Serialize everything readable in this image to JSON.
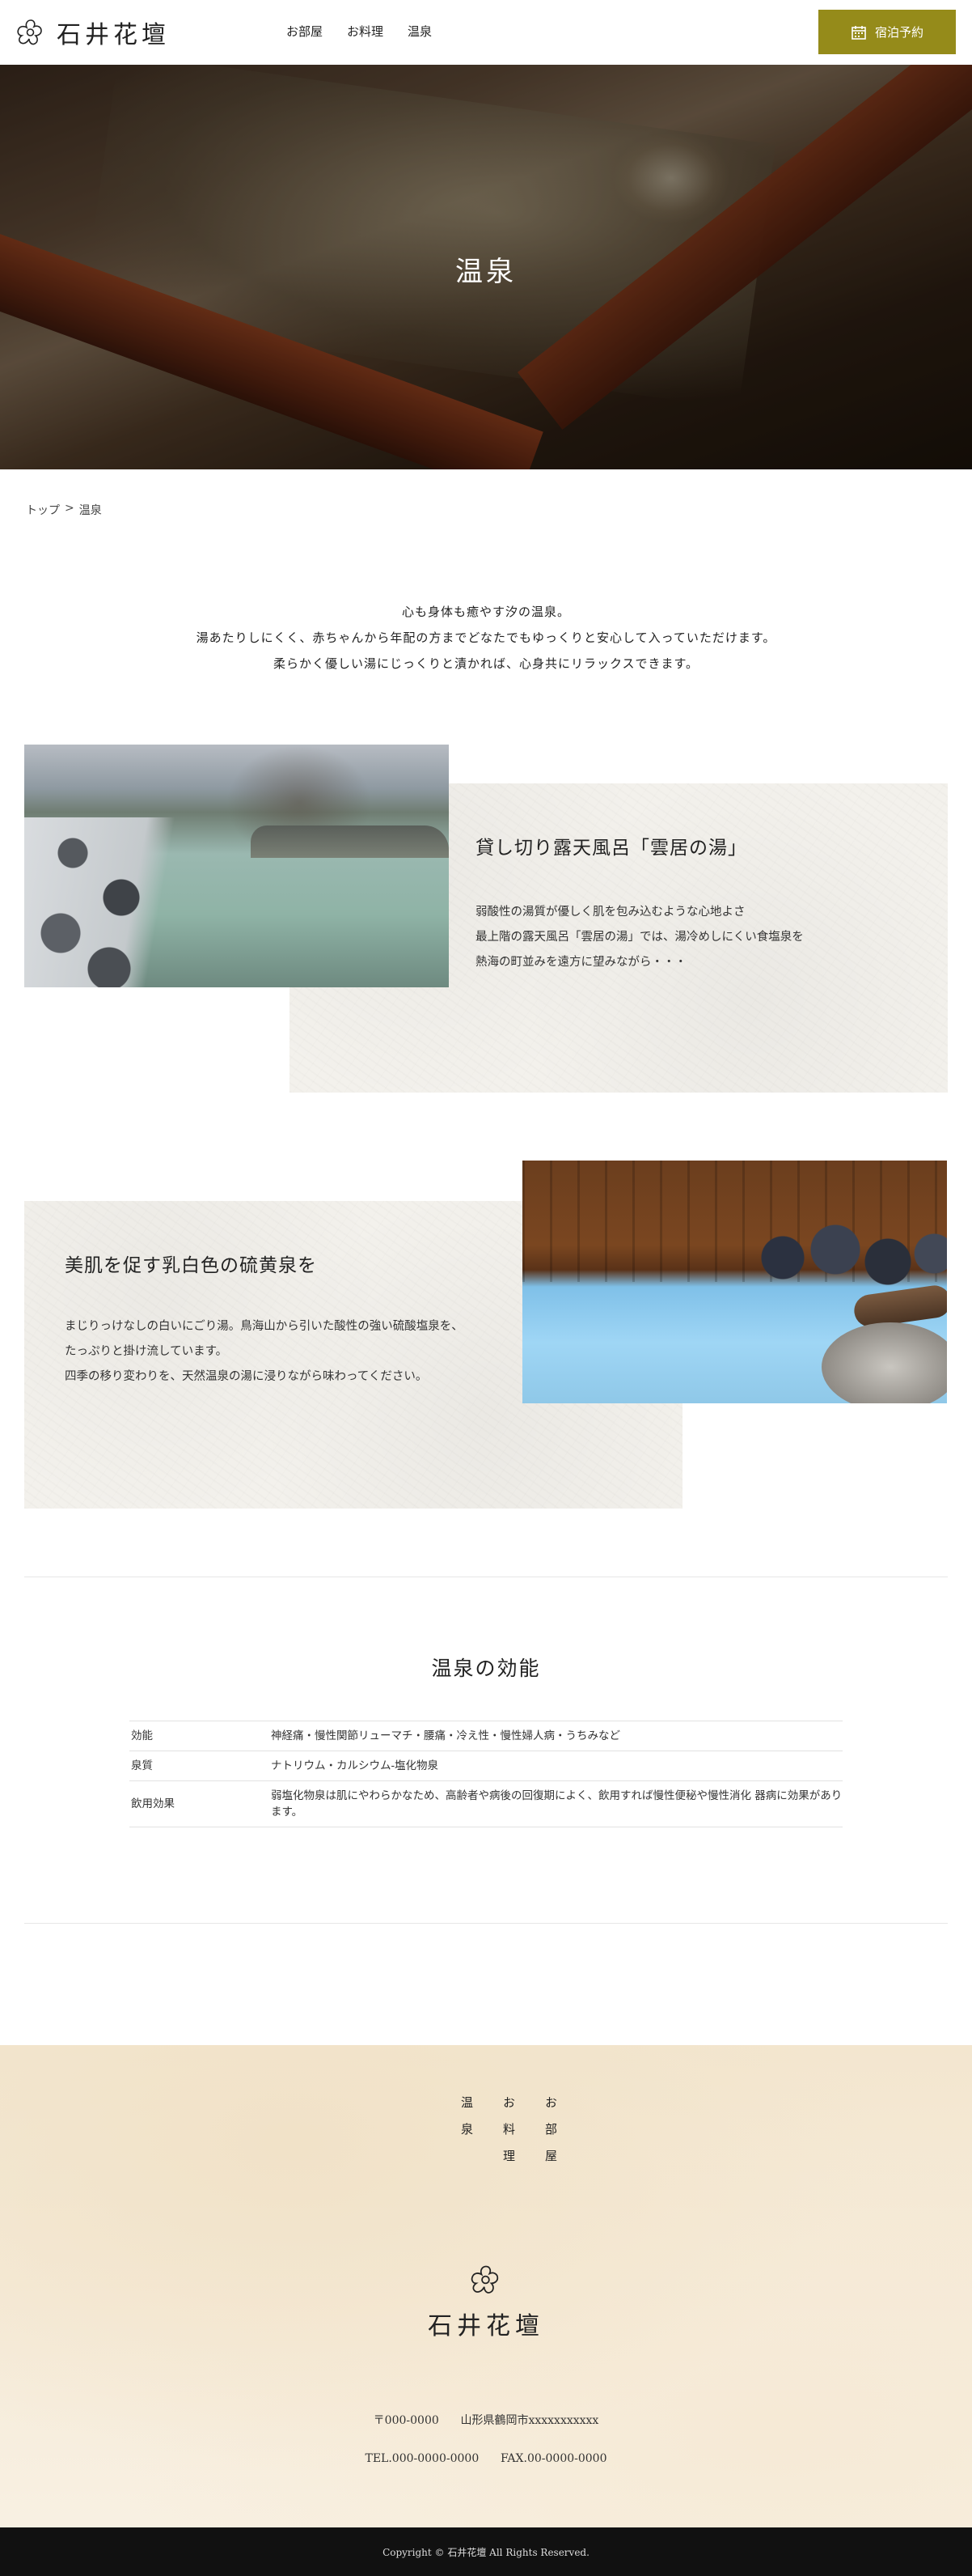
{
  "header": {
    "logo_text": "石井花壇",
    "nav": [
      "お部屋",
      "お料理",
      "温泉"
    ],
    "reserve_label": "宿泊予約",
    "accent": "#958b1a"
  },
  "hero": {
    "title": "温泉"
  },
  "breadcrumb": {
    "home": "トップ",
    "sep": ">",
    "current": "温泉"
  },
  "intro": {
    "lines": [
      "心も身体も癒やす汐の温泉。",
      "湯あたりしにくく、赤ちゃんから年配の方までどなたでもゆっくりと安心して入っていただけます。",
      "柔らかく優しい湯にじっくりと漬かれば、心身共にリラックスできます。"
    ]
  },
  "features": [
    {
      "title": "貸し切り露天風呂「雲居の湯」",
      "lines": [
        "弱酸性の湯質が優しく肌を包み込むような心地よさ",
        "最上階の露天風呂「雲居の湯」では、湯冷めしにくい食塩泉を",
        "熱海の町並みを遠方に望みながら・・・"
      ]
    },
    {
      "title": "美肌を促す乳白色の硫黄泉を",
      "lines": [
        "まじりっけなしの白いにごり湯。鳥海山から引いた酸性の強い硫酸塩泉を、",
        "たっぷりと掛け流しています。",
        "四季の移り変わりを、天然温泉の湯に浸りながら味わってください。"
      ]
    }
  ],
  "efficacy": {
    "title": "温泉の効能",
    "rows": [
      {
        "key": "効能",
        "value": "神経痛・慢性関節リューマチ・腰痛・冷え性・慢性婦人病・うちみなど"
      },
      {
        "key": "泉質",
        "value": "ナトリウム・カルシウム-塩化物泉"
      },
      {
        "key": "飲用効果",
        "value": "弱塩化物泉は肌にやわらかなため、高齢者や病後の回復期によく、飲用すれば慢性便秘や慢性消化 器病に効果があります。"
      }
    ]
  },
  "footer": {
    "nav": [
      "お部屋",
      "お料理",
      "温泉"
    ],
    "logo_text": "石井花壇",
    "postal": "〒000-0000",
    "address": "山形県鶴岡市xxxxxxxxxxx",
    "tel": "TEL.000-0000-0000",
    "fax": "FAX.00-0000-0000",
    "copyright": "Copyright © 石井花壇 All Rights Reserved."
  }
}
